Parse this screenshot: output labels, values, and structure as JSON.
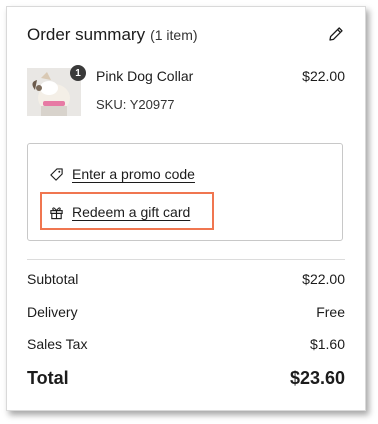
{
  "header": {
    "title": "Order summary",
    "item_count": "(1 item)",
    "edit_icon": "pencil-icon"
  },
  "item": {
    "quantity": "1",
    "name": "Pink Dog Collar",
    "sku": "SKU: Y20977",
    "price": "$22.00",
    "image": "dog-collar-photo"
  },
  "promo": {
    "promo_label": "Enter a promo code",
    "promo_icon": "tag-icon",
    "gift_label": "Redeem a gift card",
    "gift_icon": "gift-icon",
    "highlight_color": "#f07650"
  },
  "totals": {
    "subtotal_label": "Subtotal",
    "subtotal_value": "$22.00",
    "delivery_label": "Delivery",
    "delivery_value": "Free",
    "tax_label": "Sales Tax",
    "tax_value": "$1.60",
    "total_label": "Total",
    "total_value": "$23.60"
  }
}
